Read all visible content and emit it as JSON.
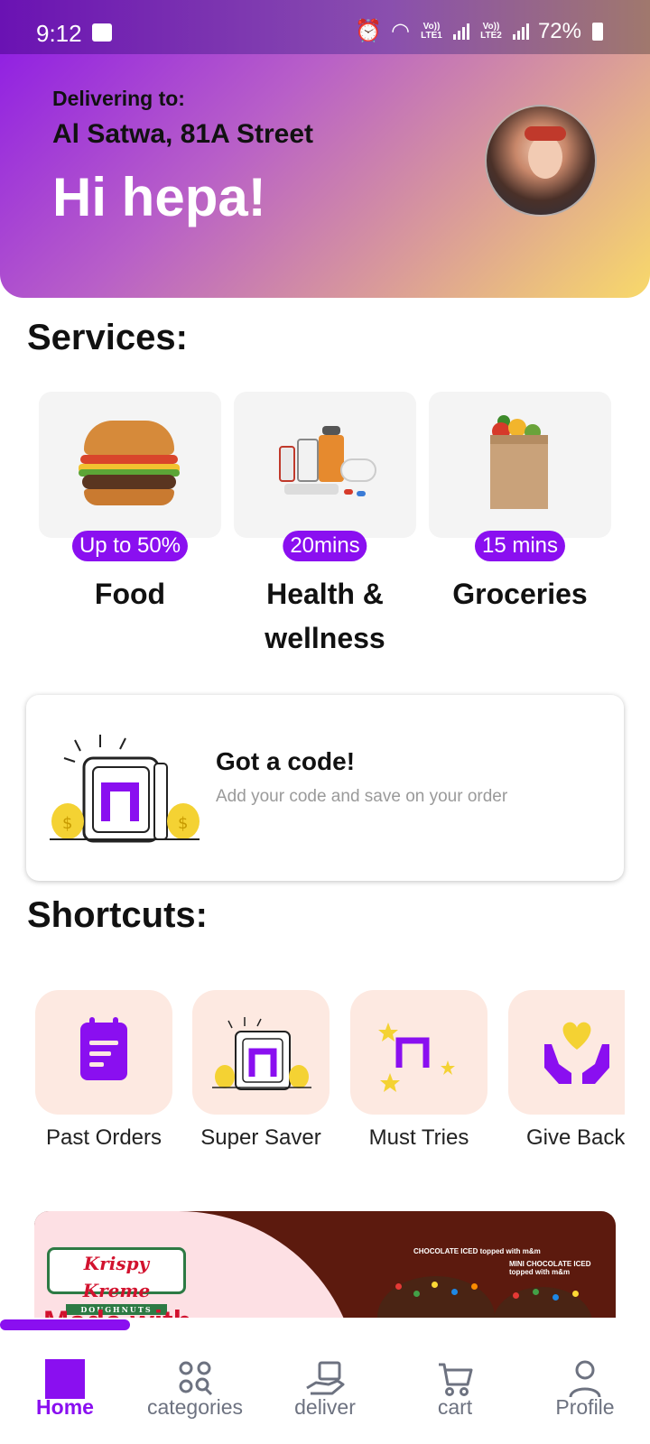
{
  "status_bar": {
    "time": "9:12",
    "battery": "72%",
    "lte1": "Vo)) LTE1",
    "lte2": "Vo)) LTE2"
  },
  "header": {
    "delivering_label": "Delivering to:",
    "address": "Al Satwa, 81A Street",
    "greeting": "Hi hepa!"
  },
  "services": {
    "title": "Services:",
    "items": [
      {
        "name": "Food",
        "badge": "Up to 50%"
      },
      {
        "name": "Health & wellness",
        "badge": "20mins"
      },
      {
        "name": "Groceries",
        "badge": "15 mins"
      }
    ]
  },
  "code_card": {
    "title": "Got a code!",
    "subtitle": "Add your code and save on your order"
  },
  "shortcuts": {
    "title": "Shortcuts:",
    "items": [
      {
        "label": "Past Orders",
        "icon": "clipboard-icon"
      },
      {
        "label": "Super Saver",
        "icon": "super-saver-icon"
      },
      {
        "label": "Must Tries",
        "icon": "must-tries-icon"
      },
      {
        "label": "Give Back",
        "icon": "give-back-icon"
      }
    ]
  },
  "banner": {
    "brand": "Krispy Kreme",
    "brand_sub": "DOUGHNUTS",
    "product1": "CHOCOLATE ICED topped with m&m",
    "product2": "MINI CHOCOLATE ICED topped with m&m",
    "partial_text": "Made with"
  },
  "bottom_nav": {
    "items": [
      {
        "label": "Home",
        "active": true
      },
      {
        "label": "categories"
      },
      {
        "label": "deliver"
      },
      {
        "label": "cart"
      },
      {
        "label": "Profile"
      }
    ]
  },
  "colors": {
    "accent": "#8a0ff0",
    "tile_bg": "#fde9e1",
    "card_bg": "#f4f4f4"
  }
}
